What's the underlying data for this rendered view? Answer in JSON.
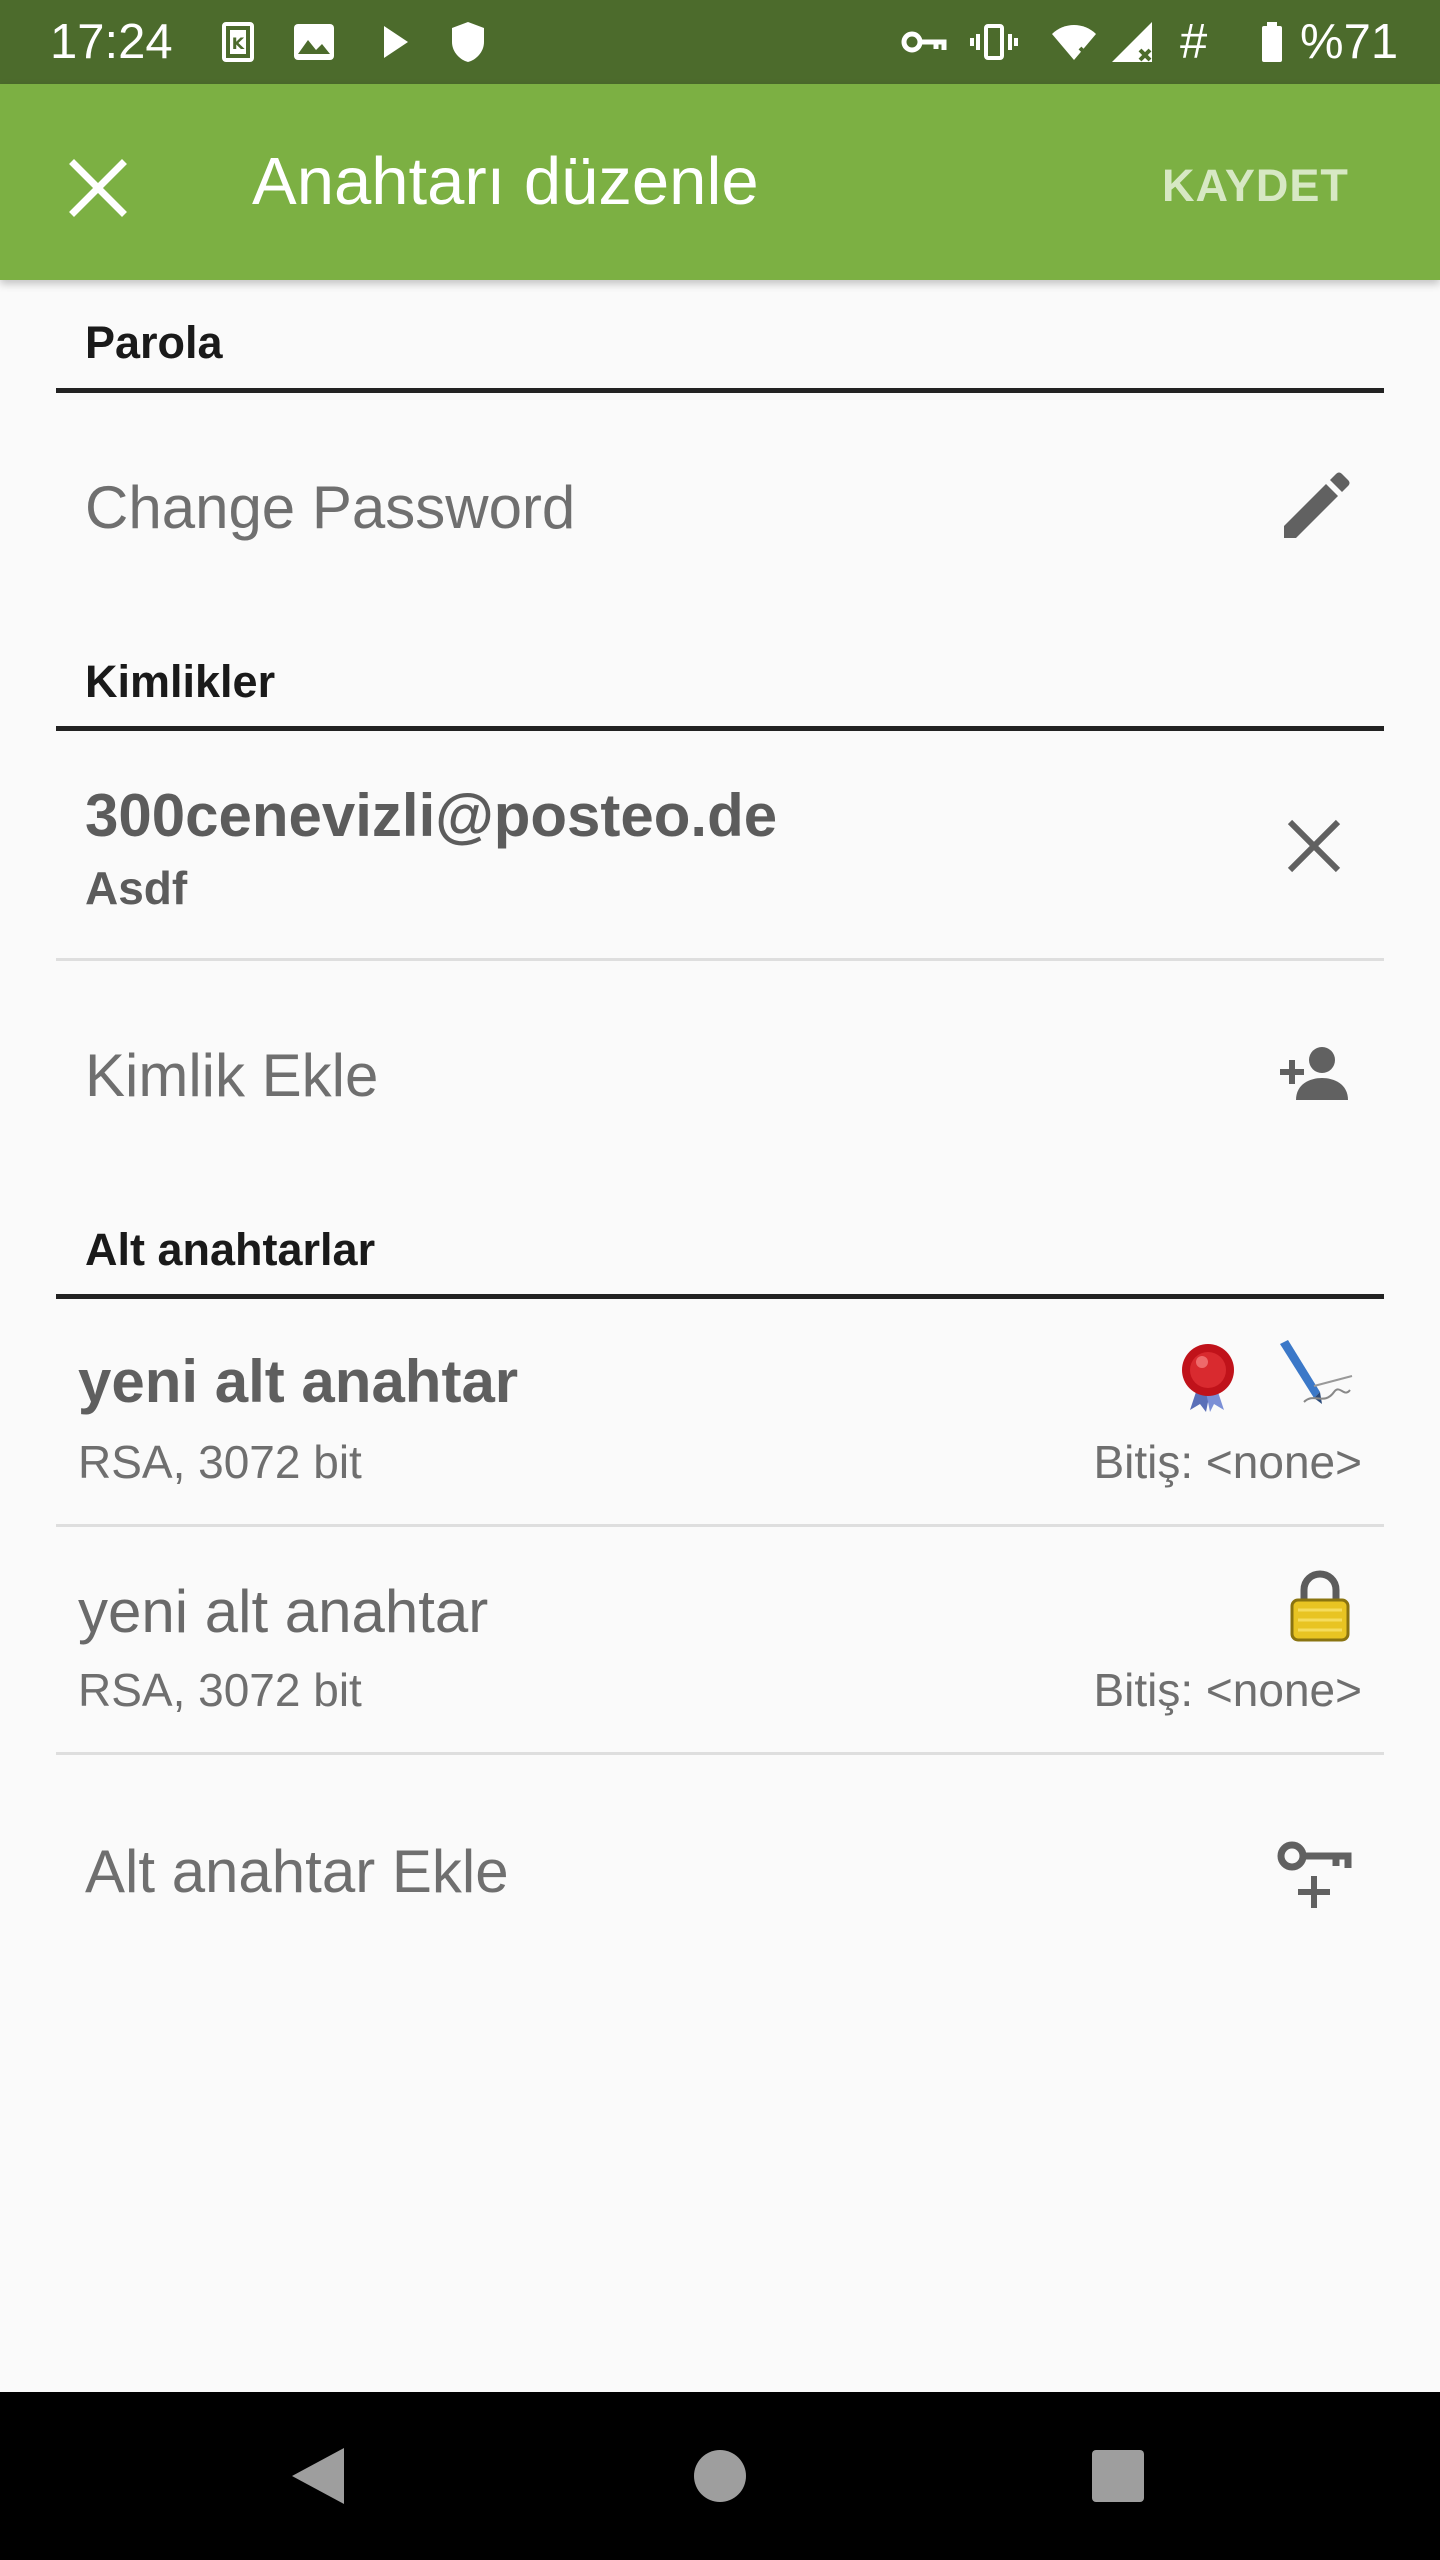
{
  "status_bar": {
    "time": "17:24",
    "battery": "%71",
    "hash": "#",
    "icons": [
      "k-app-icon",
      "image-icon",
      "play-icon",
      "shield-icon",
      "vpn-key-icon",
      "vibrate-icon",
      "wifi-icon",
      "signal-icon",
      "battery-icon"
    ]
  },
  "app_bar": {
    "title": "Anahtarı düzenle",
    "save_label": "KAYDET",
    "close_icon": "close-icon"
  },
  "sections": {
    "password": {
      "header": "Parola",
      "change_password": "Change Password",
      "icon": "pencil-icon"
    },
    "identities": {
      "header": "Kimlikler",
      "items": [
        {
          "email": "300cenevizli@posteo.de",
          "name": "Asdf",
          "icon": "close-icon"
        }
      ],
      "add_label": "Kimlik Ekle",
      "add_icon": "person-add-icon"
    },
    "subkeys": {
      "header": "Alt anahtarlar",
      "items": [
        {
          "name": "yeni alt anahtar",
          "algo": "RSA, 3072 bit",
          "expiry": "Bitiş: <none>",
          "icons": [
            "certify-seal-icon",
            "sign-pen-icon"
          ]
        },
        {
          "name": "yeni alt anahtar",
          "algo": "RSA, 3072 bit",
          "expiry": "Bitiş: <none>",
          "icons": [
            "encrypt-lock-icon"
          ]
        }
      ],
      "add_label": "Alt anahtar Ekle",
      "add_icon": "key-add-icon"
    }
  },
  "colors": {
    "status_bar": "#4c6b2c",
    "app_bar": "#7cb043",
    "background": "#fafafa",
    "nav_bar": "#000000"
  },
  "nav_bar": {
    "buttons": [
      "back-icon",
      "home-icon",
      "recents-icon"
    ]
  }
}
